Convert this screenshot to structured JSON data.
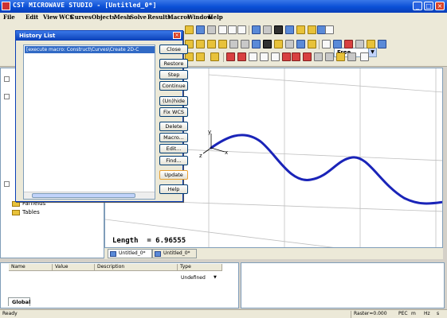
{
  "window": {
    "title": "CST MICROWAVE STUDIO - [Untitled_0*]",
    "min_symbol": "_",
    "max_symbol": "□",
    "close_symbol": "×"
  },
  "menu": [
    "File",
    "Edit",
    "View",
    "WCS",
    "Curves",
    "Objects",
    "Mesh",
    "Solve",
    "Results",
    "Macros",
    "Window",
    "Help"
  ],
  "toolbar": {
    "mode_select": "Free",
    "mode_arrow": "▼"
  },
  "history": {
    "title": "History List",
    "close_symbol": "×",
    "selected_entry": "[execute macro: Construct\\Curves\\Create 2D-C",
    "buttons": {
      "close": "Close",
      "restore": "Restore",
      "step": "Step",
      "continue": "Continue",
      "unhide": "(Un)hide",
      "fixwcs": "Fix WCS",
      "delete": "Delete",
      "macro": "Macro...",
      "edit": "Edit...",
      "find": "Find...",
      "update": "Update",
      "help": "Help"
    }
  },
  "tree": {
    "items": [
      "Farfields",
      "Tables"
    ]
  },
  "viewport": {
    "length_text": "Length  = 6.96555",
    "axis_x": "x",
    "axis_y": "y",
    "axis_z": "z",
    "curve_color": "#1a24b8",
    "tabs": [
      "Untitled_0*",
      "Untitled_0*"
    ]
  },
  "params": {
    "columns": [
      "Name",
      "Value",
      "Description",
      "Type"
    ],
    "row_type": "Undefined",
    "tab": "Global"
  },
  "status": {
    "left": "Ready",
    "raster": "Raster=0.000",
    "pec": "PEC",
    "m": "m",
    "hz": "Hz",
    "s": "s"
  }
}
